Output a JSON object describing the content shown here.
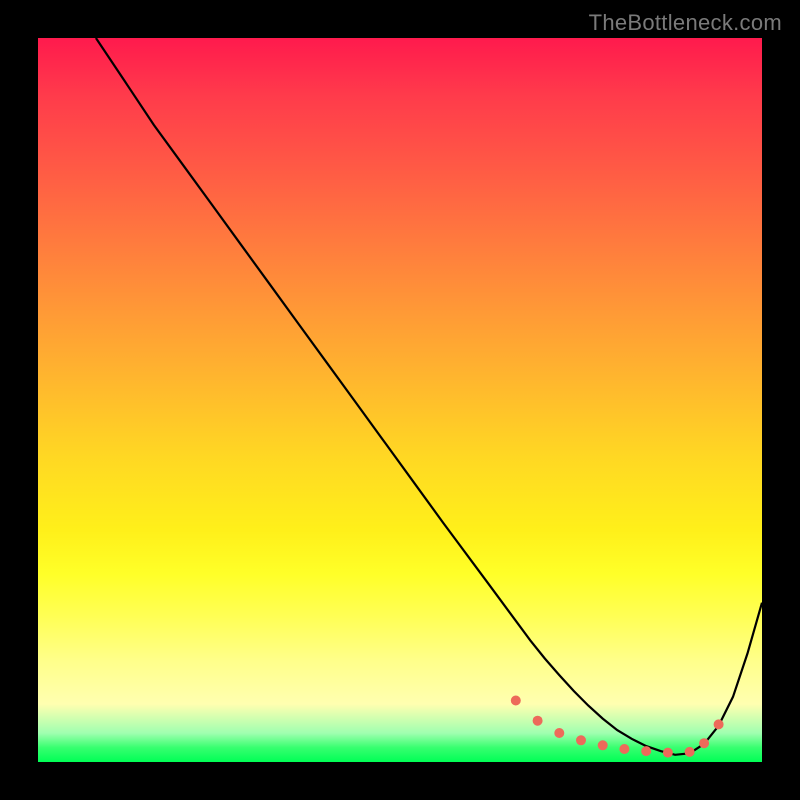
{
  "watermark": "TheBottleneck.com",
  "chart_data": {
    "type": "line",
    "title": "",
    "xlabel": "",
    "ylabel": "",
    "xlim": [
      0,
      100
    ],
    "ylim": [
      0,
      100
    ],
    "series": [
      {
        "name": "curve",
        "x": [
          8,
          12,
          16,
          20,
          24,
          28,
          32,
          36,
          40,
          44,
          48,
          52,
          56,
          58,
          60,
          62,
          64,
          66,
          68,
          70,
          72,
          74,
          76,
          78,
          80,
          82,
          84,
          86,
          88,
          90,
          92,
          94,
          96,
          98,
          100
        ],
        "values": [
          100,
          94,
          88,
          82.5,
          77,
          71.5,
          66,
          60.5,
          55,
          49.5,
          44,
          38.5,
          33,
          30.3,
          27.6,
          24.9,
          22.2,
          19.5,
          16.8,
          14.3,
          12,
          9.8,
          7.8,
          6,
          4.4,
          3.2,
          2.2,
          1.5,
          1,
          1.2,
          2.5,
          5,
          9,
          15,
          22
        ]
      }
    ],
    "markers": {
      "name": "highlight-dots",
      "color": "#ed6a5a",
      "x": [
        66,
        69,
        72,
        75,
        78,
        81,
        84,
        87,
        90,
        92,
        94
      ],
      "values": [
        8.5,
        5.7,
        4.0,
        3.0,
        2.3,
        1.8,
        1.5,
        1.3,
        1.4,
        2.6,
        5.2
      ]
    }
  }
}
